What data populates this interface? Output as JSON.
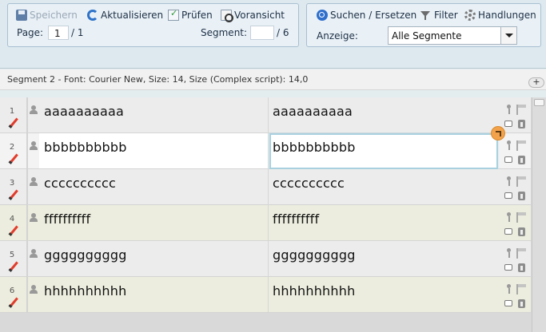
{
  "toolbar": {
    "save_label": "Speichern",
    "refresh_label": "Aktualisieren",
    "check_label": "Prüfen",
    "preview_label": "Voransicht",
    "page_label": "Page:",
    "page_value": "1",
    "page_total": "/ 1",
    "segment_label": "Segment:",
    "segment_value": "",
    "segment_total": "/ 6",
    "search_label": "Suchen / Ersetzen",
    "filter_label": "Filter",
    "actions_label": "Handlungen",
    "display_label": "Anzeige:",
    "display_value": "Alle Segmente"
  },
  "info": {
    "text": "Segment 2 - Font: Courier New, Size: 14, Size (Complex script): 14,0",
    "expand_label": "+"
  },
  "segments": [
    {
      "num": "1",
      "source": "aaaaaaaaaa",
      "target": "aaaaaaaaaa"
    },
    {
      "num": "2",
      "source": "bbbbbbbbbb",
      "target": "bbbbbbbbbb"
    },
    {
      "num": "3",
      "source": "cccccccccc",
      "target": "cccccccccc"
    },
    {
      "num": "4",
      "source": "ffffffffff",
      "target": "ffffffffff"
    },
    {
      "num": "5",
      "source": "gggggggggg",
      "target": "gggggggggg"
    },
    {
      "num": "6",
      "source": "hhhhhhhhhh",
      "target": "hhhhhhhhhh"
    }
  ],
  "colors": {
    "accent": "#2f6fcb",
    "active_row_border": "#a9d0df",
    "edit_pencil": "#e23c2c",
    "badge": "#f2a24a"
  },
  "icons": [
    "save-icon",
    "refresh-icon",
    "check-icon",
    "preview-icon",
    "search-icon",
    "filter-icon",
    "gear-icon",
    "user-icon",
    "pencil-icon",
    "pin-icon",
    "flag-icon",
    "comment-icon",
    "info-icon",
    "expand-icon"
  ]
}
